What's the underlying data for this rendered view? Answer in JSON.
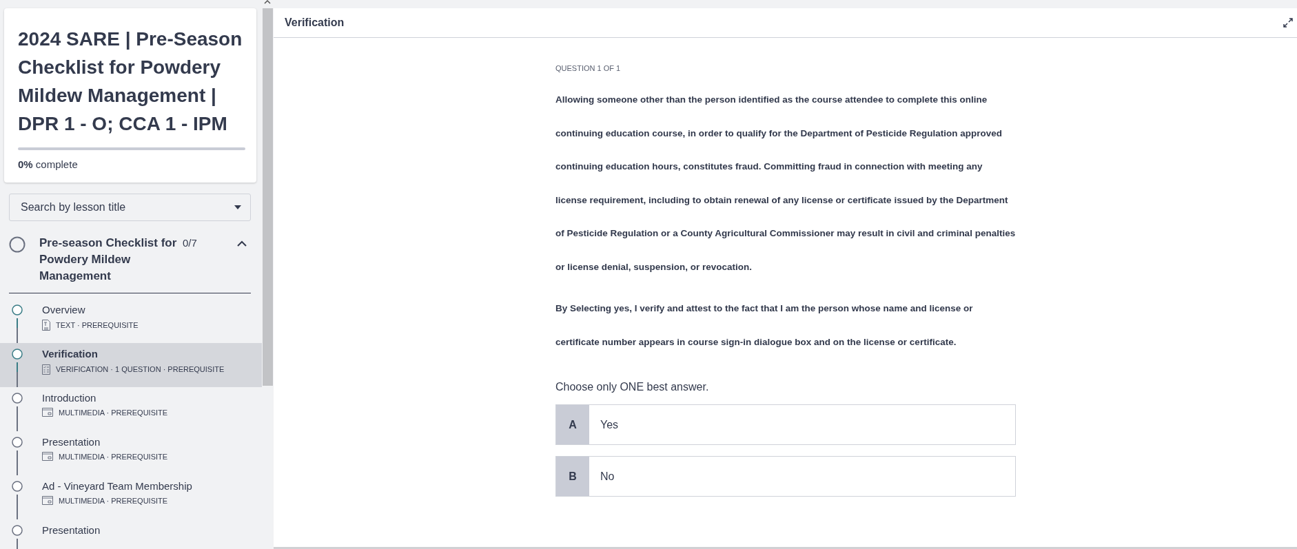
{
  "sidebar": {
    "course_title": "2024 SARE | Pre-Season Checklist for Powdery Mildew Management | DPR 1 - O; CCA 1 - IPM",
    "progress": {
      "level": 0,
      "percent": "0%",
      "label": "complete"
    },
    "search": {
      "placeholder": "Search by lesson title"
    },
    "section": {
      "title": "Pre-season Checklist for Powdery Mildew Management",
      "count": "0/7",
      "expanded": true
    },
    "lessons": [
      {
        "title": "Overview",
        "kind": "text",
        "meta": "TEXT · PREREQUISITE",
        "viewed": true,
        "selected": false
      },
      {
        "title": "Verification",
        "kind": "verification",
        "meta": "VERIFICATION · 1 QUESTION · PREREQUISITE",
        "viewed": true,
        "selected": true
      },
      {
        "title": "Introduction",
        "kind": "multimedia",
        "meta": "MULTIMEDIA · PREREQUISITE",
        "viewed": false,
        "selected": false
      },
      {
        "title": "Presentation",
        "kind": "multimedia",
        "meta": "MULTIMEDIA · PREREQUISITE",
        "viewed": false,
        "selected": false
      },
      {
        "title": "Ad - Vineyard Team Membership",
        "kind": "multimedia",
        "meta": "MULTIMEDIA · PREREQUISITE",
        "viewed": false,
        "selected": false
      },
      {
        "title": "Presentation",
        "viewed": false,
        "selected": false
      }
    ]
  },
  "main": {
    "title": "Verification",
    "question_label": "QUESTION 1 OF 1",
    "paragraphs": [
      "Allowing someone other than the person identified as the course attendee to complete this online continuing education course, in order to qualify for the Department of Pesticide Regulation approved continuing education hours, constitutes fraud. Committing fraud in connection with meeting any license requirement, including to obtain renewal of any license or certificate issued by the Department of Pesticide Regulation or a County Agricultural Commissioner may result in civil and criminal penalties or license denial, suspension, or revocation.",
      "By Selecting yes, I verify and attest to the fact that I am the person whose name and license or certificate number appears in course sign-in dialogue box and on the license or certificate."
    ],
    "instruction": "Choose only ONE best answer.",
    "answers": [
      {
        "letter": "A",
        "text": "Yes",
        "selected": false
      },
      {
        "letter": "B",
        "text": "No",
        "selected": false
      }
    ]
  }
}
